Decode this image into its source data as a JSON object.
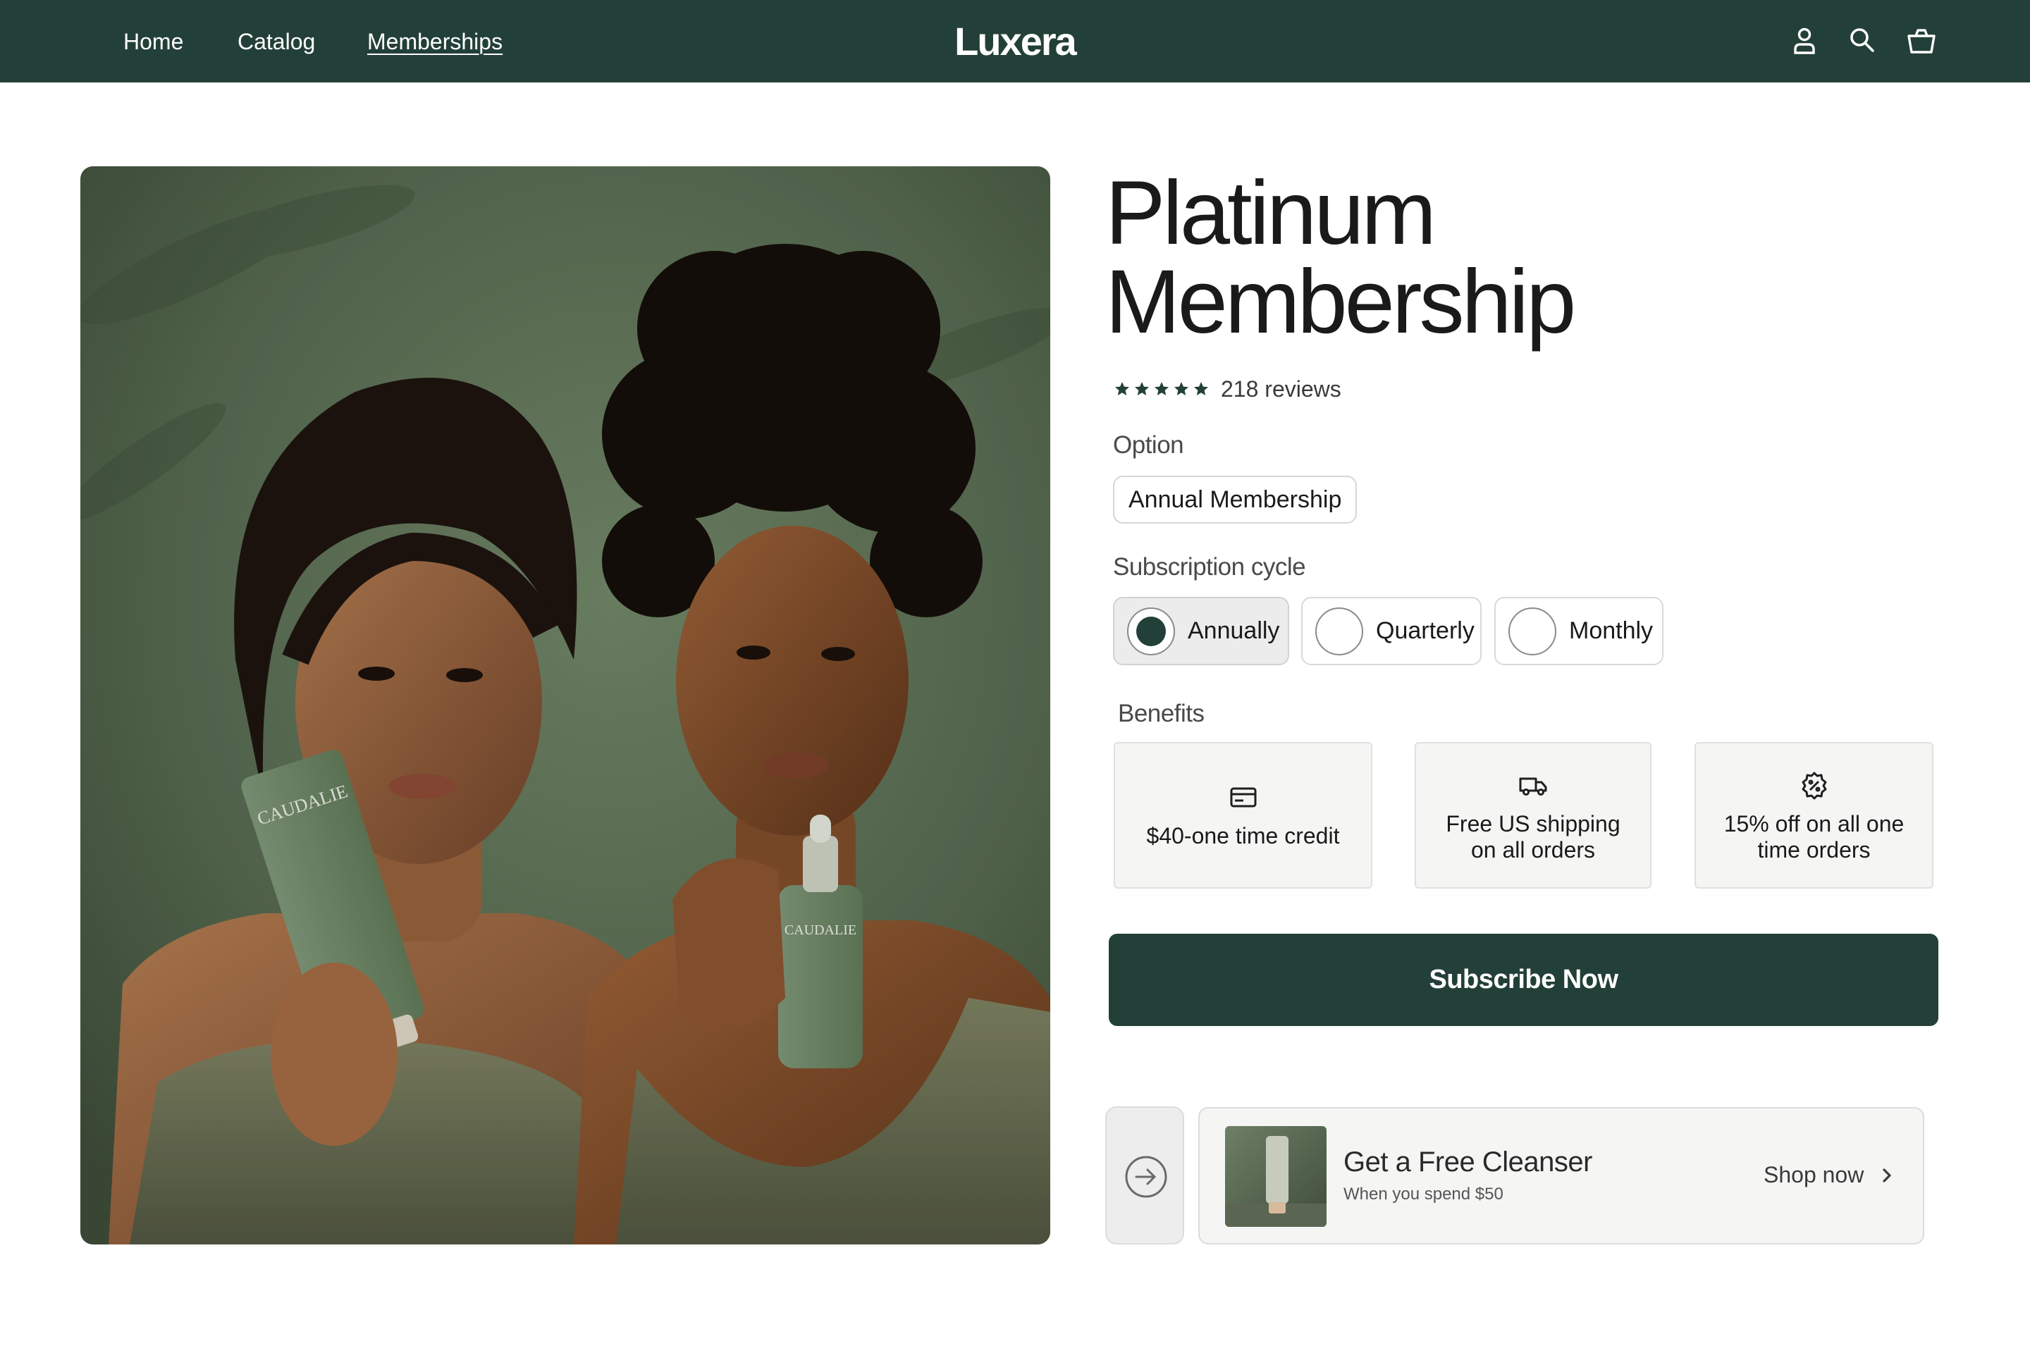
{
  "header": {
    "nav": [
      {
        "label": "Home"
      },
      {
        "label": "Catalog"
      },
      {
        "label": "Memberships",
        "active": true
      }
    ],
    "logo": "Luxera",
    "icons": [
      "user-icon",
      "search-icon",
      "cart-icon"
    ]
  },
  "hero": {
    "image": "two women holding green skincare products",
    "tube_brand": "CAUDALIE",
    "bottle_brand": "CAUDALIE"
  },
  "product": {
    "title_line1": "Platinum",
    "title_line2": "Membership",
    "rating_stars": 5,
    "reviews": "218 reviews"
  },
  "option": {
    "label": "Option",
    "selected": "Annual Membership"
  },
  "cycle": {
    "label": "Subscription cycle",
    "options": [
      {
        "label": "Annually",
        "selected": true
      },
      {
        "label": "Quarterly",
        "selected": false
      },
      {
        "label": "Monthly",
        "selected": false
      }
    ]
  },
  "benefits": {
    "label": "Benefits",
    "items": [
      {
        "icon": "credit-card-icon",
        "text": "$40-one time credit"
      },
      {
        "icon": "truck-icon",
        "line1": "Free US shipping",
        "line2": "on all orders"
      },
      {
        "icon": "discount-badge-icon",
        "line1": "15% off on all one",
        "line2": "time orders"
      }
    ]
  },
  "cta": {
    "subscribe": "Subscribe Now"
  },
  "promo": {
    "title": "Get a Free Cleanser",
    "subtitle": "When you spend $50",
    "link": "Shop now"
  },
  "colors": {
    "brand": "#234038",
    "background": "#ffffff",
    "card_bg": "#f5f5f4"
  }
}
